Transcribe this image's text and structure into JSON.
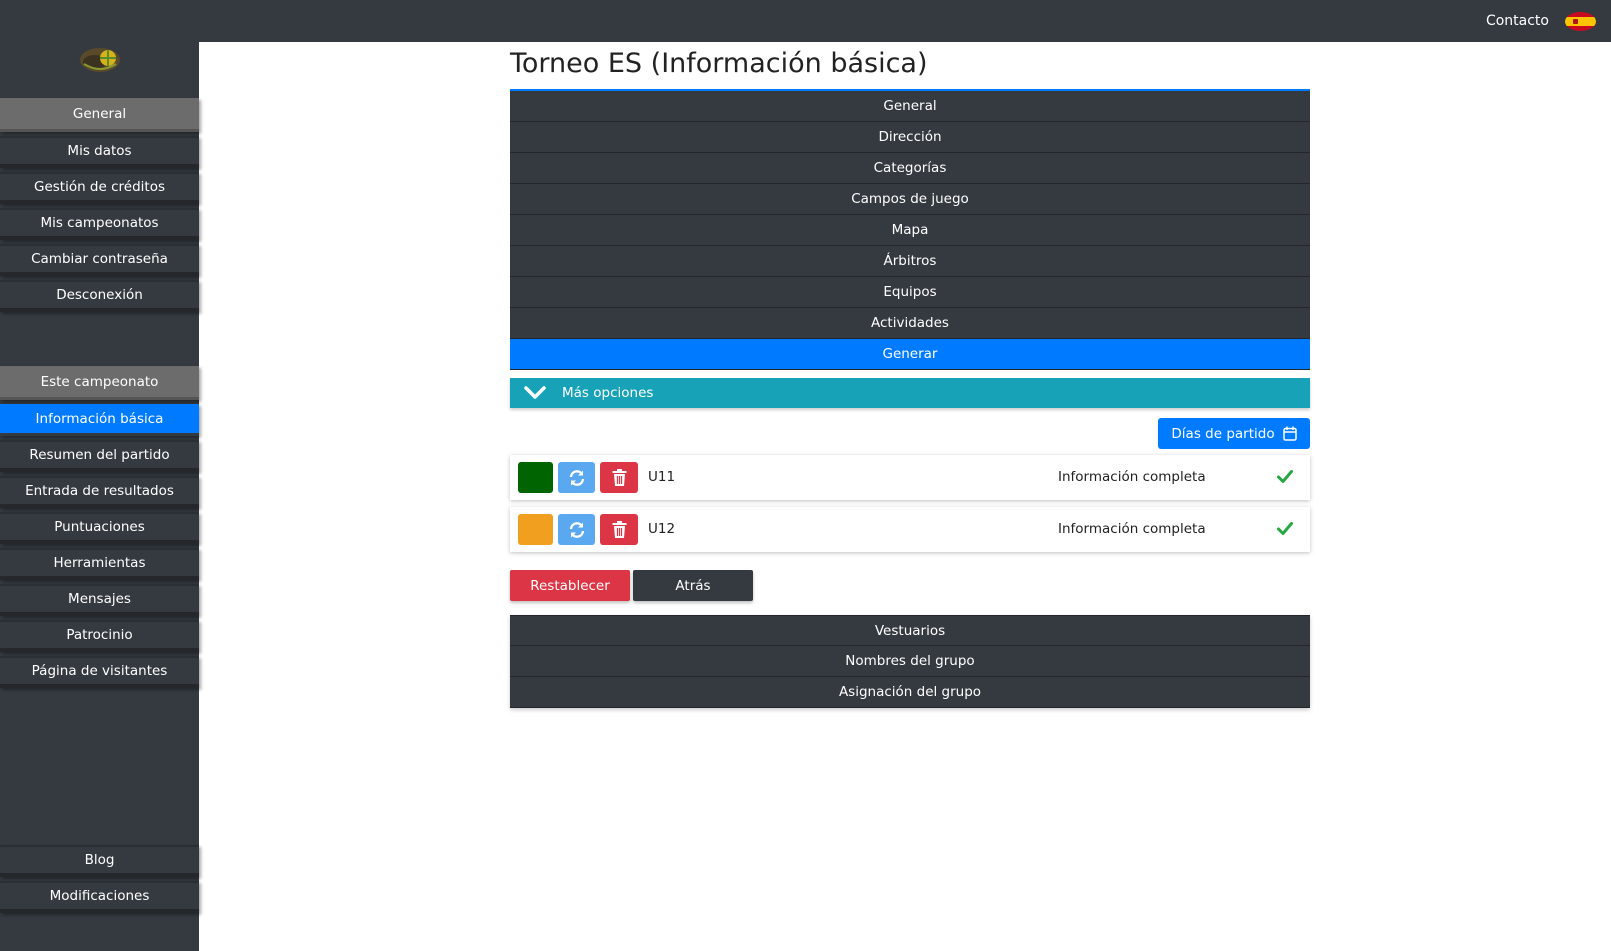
{
  "topbar": {
    "contact_label": "Contacto",
    "language_flag": "spain-flag-icon"
  },
  "sidebar": {
    "general_header": "General",
    "general_items": [
      {
        "label": "Mis datos"
      },
      {
        "label": "Gestión de créditos"
      },
      {
        "label": "Mis campeonatos"
      },
      {
        "label": "Cambiar contraseña"
      },
      {
        "label": "Desconexión"
      }
    ],
    "championship_header": "Este campeonato",
    "championship_items": [
      {
        "label": "Información básica",
        "active": true
      },
      {
        "label": "Resumen del partido"
      },
      {
        "label": "Entrada de resultados"
      },
      {
        "label": "Puntuaciones"
      },
      {
        "label": "Herramientas"
      },
      {
        "label": "Mensajes"
      },
      {
        "label": "Patrocinio"
      },
      {
        "label": "Página de visitantes"
      }
    ],
    "footer_items": [
      {
        "label": "Blog"
      },
      {
        "label": "Modificaciones"
      }
    ]
  },
  "main": {
    "title": "Torneo ES (Información básica)",
    "tabs": [
      {
        "label": "General"
      },
      {
        "label": "Dirección"
      },
      {
        "label": "Categorías"
      },
      {
        "label": "Campos de juego"
      },
      {
        "label": "Mapa"
      },
      {
        "label": "Árbitros"
      },
      {
        "label": "Equipos"
      },
      {
        "label": "Actividades"
      },
      {
        "label": "Generar",
        "active": true
      }
    ],
    "more_options_label": "Más opciones",
    "days_button_label": "Días de partido",
    "categories": [
      {
        "name": "U11",
        "status": "Información completa",
        "color": "#006400"
      },
      {
        "name": "U12",
        "status": "Información completa",
        "color": "#f0a01e"
      }
    ],
    "reset_label": "Restablecer",
    "back_label": "Atrás",
    "bottom_tabs": [
      {
        "label": "Vestuarios"
      },
      {
        "label": "Nombres del grupo"
      },
      {
        "label": "Asignación del grupo"
      }
    ]
  },
  "colors": {
    "dark": "#343a40",
    "primary": "#007bff",
    "info": "#17a2b8",
    "danger": "#dc3545",
    "success": "#28a745"
  }
}
